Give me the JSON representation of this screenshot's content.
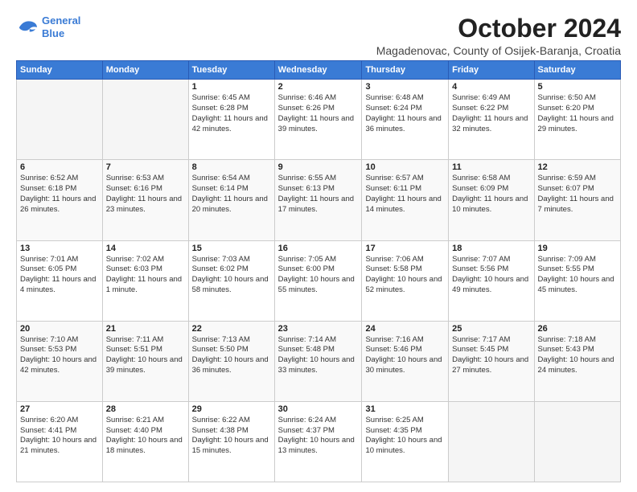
{
  "logo": {
    "line1": "General",
    "line2": "Blue"
  },
  "title": "October 2024",
  "subtitle": "Magadenovac, County of Osijek-Baranja, Croatia",
  "days_of_week": [
    "Sunday",
    "Monday",
    "Tuesday",
    "Wednesday",
    "Thursday",
    "Friday",
    "Saturday"
  ],
  "weeks": [
    [
      {
        "day": "",
        "detail": ""
      },
      {
        "day": "",
        "detail": ""
      },
      {
        "day": "1",
        "detail": "Sunrise: 6:45 AM\nSunset: 6:28 PM\nDaylight: 11 hours and 42 minutes."
      },
      {
        "day": "2",
        "detail": "Sunrise: 6:46 AM\nSunset: 6:26 PM\nDaylight: 11 hours and 39 minutes."
      },
      {
        "day": "3",
        "detail": "Sunrise: 6:48 AM\nSunset: 6:24 PM\nDaylight: 11 hours and 36 minutes."
      },
      {
        "day": "4",
        "detail": "Sunrise: 6:49 AM\nSunset: 6:22 PM\nDaylight: 11 hours and 32 minutes."
      },
      {
        "day": "5",
        "detail": "Sunrise: 6:50 AM\nSunset: 6:20 PM\nDaylight: 11 hours and 29 minutes."
      }
    ],
    [
      {
        "day": "6",
        "detail": "Sunrise: 6:52 AM\nSunset: 6:18 PM\nDaylight: 11 hours and 26 minutes."
      },
      {
        "day": "7",
        "detail": "Sunrise: 6:53 AM\nSunset: 6:16 PM\nDaylight: 11 hours and 23 minutes."
      },
      {
        "day": "8",
        "detail": "Sunrise: 6:54 AM\nSunset: 6:14 PM\nDaylight: 11 hours and 20 minutes."
      },
      {
        "day": "9",
        "detail": "Sunrise: 6:55 AM\nSunset: 6:13 PM\nDaylight: 11 hours and 17 minutes."
      },
      {
        "day": "10",
        "detail": "Sunrise: 6:57 AM\nSunset: 6:11 PM\nDaylight: 11 hours and 14 minutes."
      },
      {
        "day": "11",
        "detail": "Sunrise: 6:58 AM\nSunset: 6:09 PM\nDaylight: 11 hours and 10 minutes."
      },
      {
        "day": "12",
        "detail": "Sunrise: 6:59 AM\nSunset: 6:07 PM\nDaylight: 11 hours and 7 minutes."
      }
    ],
    [
      {
        "day": "13",
        "detail": "Sunrise: 7:01 AM\nSunset: 6:05 PM\nDaylight: 11 hours and 4 minutes."
      },
      {
        "day": "14",
        "detail": "Sunrise: 7:02 AM\nSunset: 6:03 PM\nDaylight: 11 hours and 1 minute."
      },
      {
        "day": "15",
        "detail": "Sunrise: 7:03 AM\nSunset: 6:02 PM\nDaylight: 10 hours and 58 minutes."
      },
      {
        "day": "16",
        "detail": "Sunrise: 7:05 AM\nSunset: 6:00 PM\nDaylight: 10 hours and 55 minutes."
      },
      {
        "day": "17",
        "detail": "Sunrise: 7:06 AM\nSunset: 5:58 PM\nDaylight: 10 hours and 52 minutes."
      },
      {
        "day": "18",
        "detail": "Sunrise: 7:07 AM\nSunset: 5:56 PM\nDaylight: 10 hours and 49 minutes."
      },
      {
        "day": "19",
        "detail": "Sunrise: 7:09 AM\nSunset: 5:55 PM\nDaylight: 10 hours and 45 minutes."
      }
    ],
    [
      {
        "day": "20",
        "detail": "Sunrise: 7:10 AM\nSunset: 5:53 PM\nDaylight: 10 hours and 42 minutes."
      },
      {
        "day": "21",
        "detail": "Sunrise: 7:11 AM\nSunset: 5:51 PM\nDaylight: 10 hours and 39 minutes."
      },
      {
        "day": "22",
        "detail": "Sunrise: 7:13 AM\nSunset: 5:50 PM\nDaylight: 10 hours and 36 minutes."
      },
      {
        "day": "23",
        "detail": "Sunrise: 7:14 AM\nSunset: 5:48 PM\nDaylight: 10 hours and 33 minutes."
      },
      {
        "day": "24",
        "detail": "Sunrise: 7:16 AM\nSunset: 5:46 PM\nDaylight: 10 hours and 30 minutes."
      },
      {
        "day": "25",
        "detail": "Sunrise: 7:17 AM\nSunset: 5:45 PM\nDaylight: 10 hours and 27 minutes."
      },
      {
        "day": "26",
        "detail": "Sunrise: 7:18 AM\nSunset: 5:43 PM\nDaylight: 10 hours and 24 minutes."
      }
    ],
    [
      {
        "day": "27",
        "detail": "Sunrise: 6:20 AM\nSunset: 4:41 PM\nDaylight: 10 hours and 21 minutes."
      },
      {
        "day": "28",
        "detail": "Sunrise: 6:21 AM\nSunset: 4:40 PM\nDaylight: 10 hours and 18 minutes."
      },
      {
        "day": "29",
        "detail": "Sunrise: 6:22 AM\nSunset: 4:38 PM\nDaylight: 10 hours and 15 minutes."
      },
      {
        "day": "30",
        "detail": "Sunrise: 6:24 AM\nSunset: 4:37 PM\nDaylight: 10 hours and 13 minutes."
      },
      {
        "day": "31",
        "detail": "Sunrise: 6:25 AM\nSunset: 4:35 PM\nDaylight: 10 hours and 10 minutes."
      },
      {
        "day": "",
        "detail": ""
      },
      {
        "day": "",
        "detail": ""
      }
    ]
  ]
}
